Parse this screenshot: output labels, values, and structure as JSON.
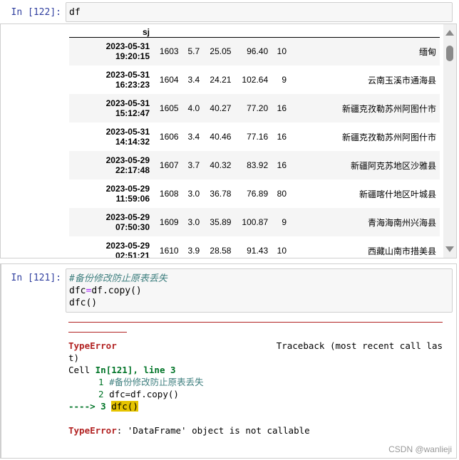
{
  "cell1": {
    "prompt": "In [122]:",
    "code": "df"
  },
  "table": {
    "header_index": "sj",
    "rows": [
      {
        "date": "2023-05-31",
        "time": "19:20:15",
        "id": "1603",
        "mag": "5.7",
        "lat": "25.05",
        "lon": "96.40",
        "depth": "10",
        "loc": "缅甸"
      },
      {
        "date": "2023-05-31",
        "time": "16:23:23",
        "id": "1604",
        "mag": "3.4",
        "lat": "24.21",
        "lon": "102.64",
        "depth": "9",
        "loc": "云南玉溪市通海县"
      },
      {
        "date": "2023-05-31",
        "time": "15:12:47",
        "id": "1605",
        "mag": "4.0",
        "lat": "40.27",
        "lon": "77.20",
        "depth": "16",
        "loc": "新疆克孜勒苏州阿图什市"
      },
      {
        "date": "2023-05-31",
        "time": "14:14:32",
        "id": "1606",
        "mag": "3.4",
        "lat": "40.46",
        "lon": "77.16",
        "depth": "16",
        "loc": "新疆克孜勒苏州阿图什市"
      },
      {
        "date": "2023-05-29",
        "time": "22:17:48",
        "id": "1607",
        "mag": "3.7",
        "lat": "40.32",
        "lon": "83.92",
        "depth": "16",
        "loc": "新疆阿克苏地区沙雅县"
      },
      {
        "date": "2023-05-29",
        "time": "11:59:06",
        "id": "1608",
        "mag": "3.0",
        "lat": "36.78",
        "lon": "76.89",
        "depth": "80",
        "loc": "新疆喀什地区叶城县"
      },
      {
        "date": "2023-05-29",
        "time": "07:50:30",
        "id": "1609",
        "mag": "3.0",
        "lat": "35.89",
        "lon": "100.87",
        "depth": "9",
        "loc": "青海海南州兴海县"
      },
      {
        "date": "2023-05-29",
        "time": "02:51:21",
        "id": "1610",
        "mag": "3.9",
        "lat": "28.58",
        "lon": "91.43",
        "depth": "10",
        "loc": "西藏山南市措美县"
      }
    ]
  },
  "cell2": {
    "prompt": "In [121]:",
    "line1": "#备份修改防止原表丢失",
    "line2_a": "dfc",
    "line2_op": "=",
    "line2_b": "df.copy()",
    "line3": "dfc()"
  },
  "traceback": {
    "error_name": "TypeError",
    "header_right": "Traceback (most recent call las",
    "header_wrap": "t)",
    "cell_prefix": "Cell ",
    "cell_ref": "In[121], line 3",
    "ctx1_no": "1",
    "ctx1_code": "#备份修改防止原表丢失",
    "ctx2_no": "2",
    "ctx2_code": "dfc=df.copy()",
    "arrow": "----> 3",
    "ctx3_code": "dfc()",
    "final_error_name": "TypeError",
    "final_message": ": 'DataFrame' object is not callable"
  },
  "watermark": "CSDN @wanlieji"
}
